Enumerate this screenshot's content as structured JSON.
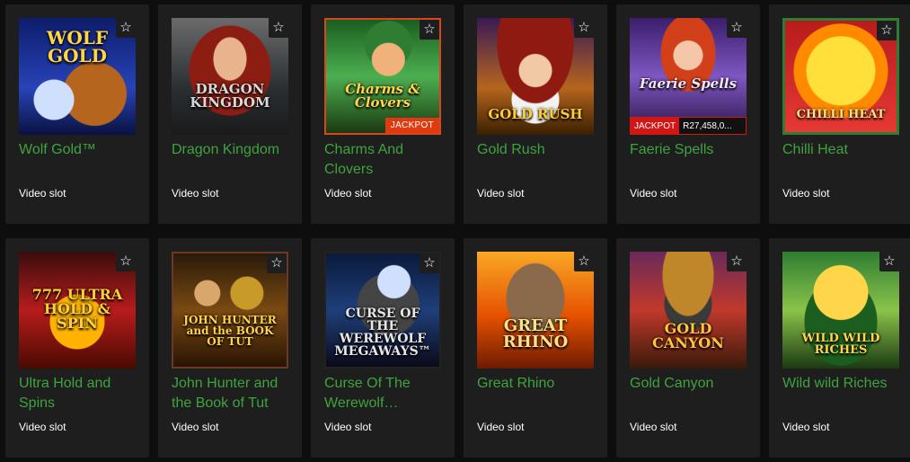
{
  "games": [
    {
      "title": "Wolf Gold™",
      "type": "Video slot",
      "logo": "WOLF GOLD"
    },
    {
      "title": "Dragon Kingdom",
      "type": "Video slot",
      "logo": "DRAGON KINGDOM"
    },
    {
      "title": "Charms And Clovers",
      "type": "Video slot",
      "logo": "Charms & Clovers",
      "badge": "JACKPOT"
    },
    {
      "title": "Gold Rush",
      "type": "Video slot",
      "logo": "GOLD RUSH"
    },
    {
      "title": "Faerie Spells",
      "type": "Video slot",
      "logo": "Faerie Spells",
      "jackpot_label": "JACKPOT",
      "jackpot_amount": "R27,458,0..."
    },
    {
      "title": "Chilli Heat",
      "type": "Video slot",
      "logo": "CHILLI HEAT"
    },
    {
      "title": "Ultra Hold and Spins",
      "type": "Video slot",
      "logo": "777 ULTRA HOLD & SPIN"
    },
    {
      "title": "John Hunter and the Book of Tut",
      "type": "Video slot",
      "logo": "JOHN HUNTER and the BOOK OF TUT"
    },
    {
      "title": "Curse Of The Werewolf…",
      "type": "Video slot",
      "logo": "CURSE OF THE WEREWOLF MEGAWAYS™"
    },
    {
      "title": "Great Rhino",
      "type": "Video slot",
      "logo": "GREAT RHINO"
    },
    {
      "title": "Gold Canyon",
      "type": "Video slot",
      "logo": "GOLD CANYON"
    },
    {
      "title": "Wild wild Riches",
      "type": "Video slot",
      "logo": "WILD WILD RICHES"
    }
  ],
  "favorite_icon": "star-outline-icon",
  "colors": {
    "title": "#3ea43e",
    "card": "#1e1e1e",
    "jackpot": "#e03a10"
  }
}
